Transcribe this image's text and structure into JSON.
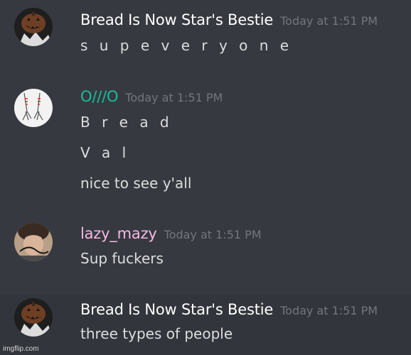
{
  "messages": [
    {
      "author": "Bread Is Now Star's Bestie",
      "author_color": "#ffffff",
      "timestamp": "Today at 1:51 PM",
      "lines": [
        "s u p e v e r y o n e"
      ]
    },
    {
      "author": "O///O",
      "author_color": "#1abc9c",
      "timestamp": "Today at 1:51 PM",
      "lines": [
        "B r e a d",
        "V a l",
        "nice to see y'all"
      ]
    },
    {
      "author": "lazy_mazy",
      "author_color": "#f6b8e3",
      "timestamp": "Today at 1:51 PM",
      "lines": [
        "Sup fuckers"
      ]
    },
    {
      "author": "Bread Is Now Star's Bestie",
      "author_color": "#ffffff",
      "timestamp": "Today at 1:51 PM",
      "lines": [
        "three types of people"
      ]
    }
  ],
  "watermark": "imgflip.com",
  "colors": {
    "background": "#36393f",
    "hover_background": "#32353b",
    "timestamp": "#72767d",
    "message_text": "#dcddde"
  }
}
